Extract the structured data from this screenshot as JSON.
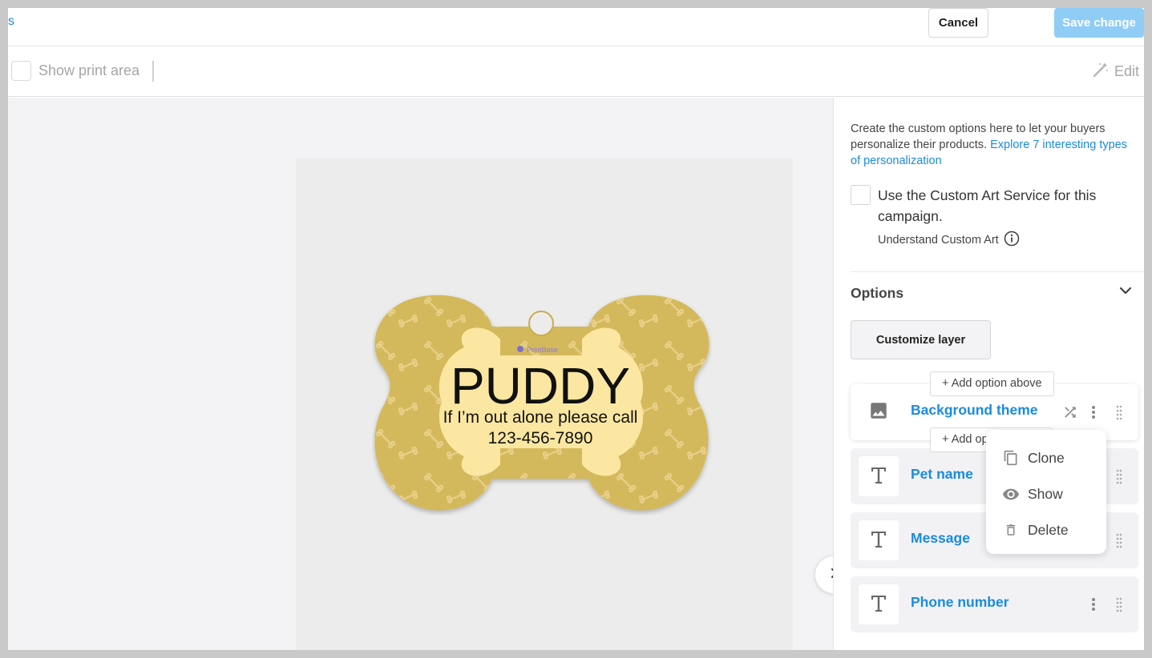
{
  "header": {
    "back_label": "s",
    "cancel_label": "Cancel",
    "save_label": "Save change"
  },
  "toolbar": {
    "show_print_area_label": "Show print area",
    "edit_label": "Edit"
  },
  "preview": {
    "logo_text": "PrintBase",
    "pet_name": "PUDDY",
    "message": "If I’m out alone please call",
    "phone": "123-456-7890"
  },
  "panel": {
    "intro_text": "Create the custom options here to let your buyers personalize their products.",
    "intro_link": "Explore 7 interesting types of personalization",
    "custom_art_label": "Use the Custom Art Service for this campaign.",
    "custom_art_link": "Understand Custom Art",
    "options_title": "Options",
    "customize_layer_label": "Customize layer",
    "add_above_label": "+ Add option above",
    "add_below_label": "+ Add option below",
    "options": [
      {
        "name": "Background theme",
        "icon": "image-icon"
      },
      {
        "name": "Pet name",
        "icon": "text-icon"
      },
      {
        "name": "Message",
        "icon": "text-icon"
      },
      {
        "name": "Phone number",
        "icon": "text-icon"
      }
    ],
    "menu": {
      "clone_label": "Clone",
      "show_label": "Show",
      "delete_label": "Delete"
    }
  },
  "colors": {
    "accent": "#1a8be0",
    "save_disabled": "#8fcdf6",
    "tag_gold": "#d4b95b",
    "tag_cream": "#fbe7a1"
  }
}
